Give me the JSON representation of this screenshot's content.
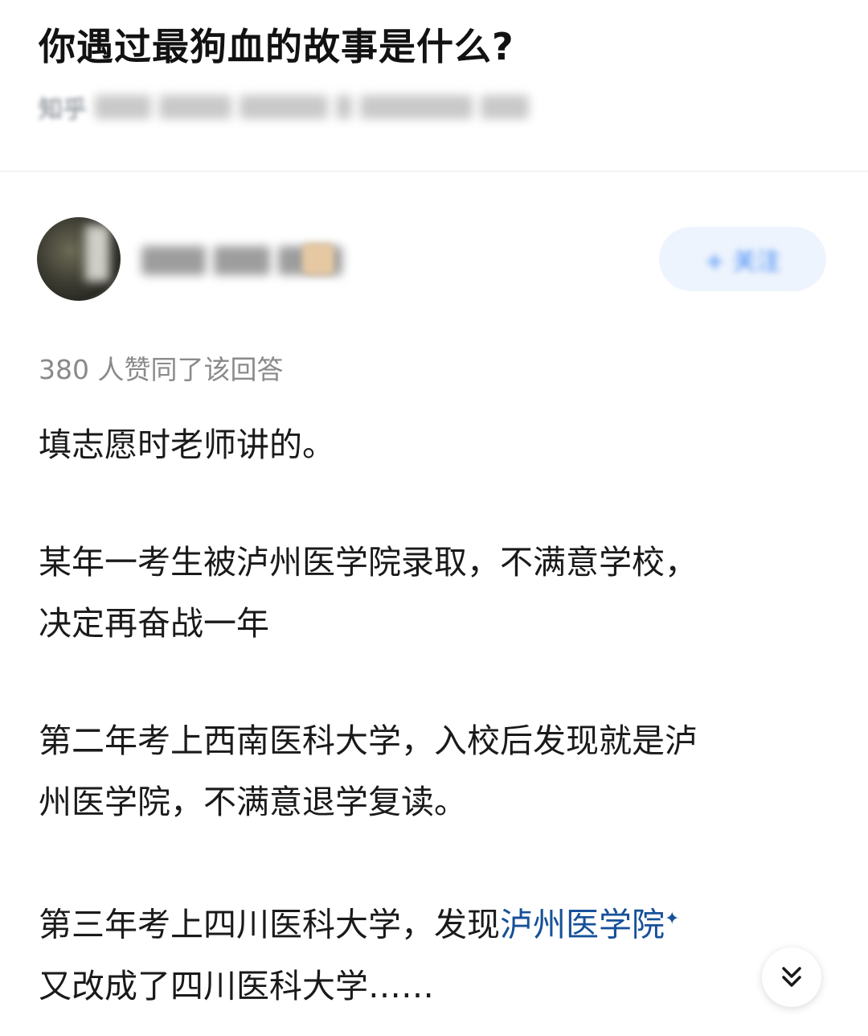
{
  "question": {
    "title": "你遇过最狗血的故事是什么?",
    "source_label": "知乎"
  },
  "answer": {
    "follow_label": "+ 关注",
    "vote_text": "380 人赞同了该回答",
    "paragraphs": [
      [
        "填志愿时老师讲的。"
      ],
      [
        "某年一考生被泸州医学院录取，不满意学校，",
        "决定再奋战一年"
      ],
      [
        "第二年考上西南医科大学，入校后发现就是泸",
        "州医学院，不满意退学复读。"
      ]
    ],
    "last_paragraph": {
      "line1_prefix": "第三年考上四川医科大学，发现",
      "line1_link": "泸州医学院",
      "link_mark": "✦",
      "line2": "又改成了四川医科大学……"
    }
  },
  "colors": {
    "link": "#175199",
    "follow_bg": "#eef4fd",
    "follow_text": "#3d86f5",
    "muted_text": "#8a8a8a"
  },
  "icons": {
    "expand": "chevrons-down-icon"
  }
}
